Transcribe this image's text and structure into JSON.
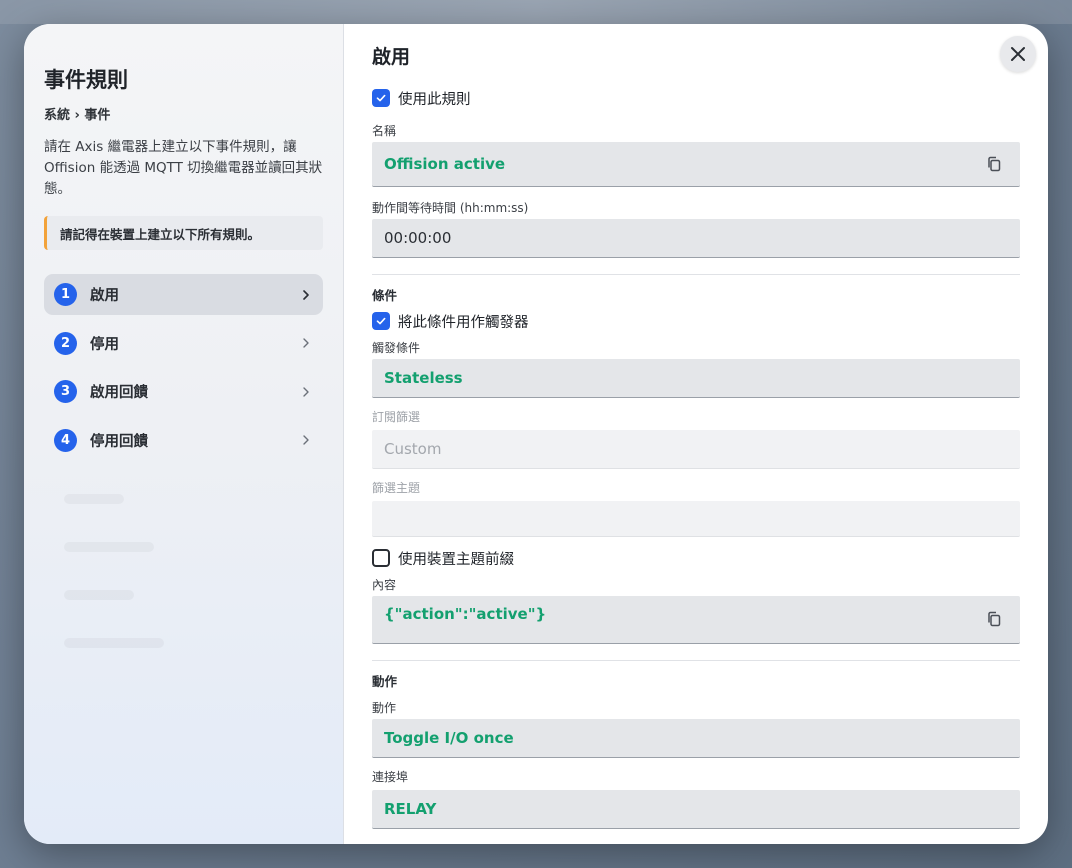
{
  "sidebar": {
    "title": "事件規則",
    "breadcrumb": "系統 › 事件",
    "description": "請在 Axis 繼電器上建立以下事件規則，讓 Offision 能透過 MQTT 切換繼電器並讀回其狀態。",
    "note": "請記得在裝置上建立以下所有規則。",
    "steps": [
      {
        "num": "1",
        "label": "啟用"
      },
      {
        "num": "2",
        "label": "停用"
      },
      {
        "num": "3",
        "label": "啟用回饋"
      },
      {
        "num": "4",
        "label": "停用回饋"
      }
    ]
  },
  "main": {
    "title": "啟用",
    "use_rule_label": "使用此規則",
    "name_label": "名稱",
    "name_value": "Offision active",
    "wait_label": "動作間等待時間 (hh:mm:ss)",
    "wait_value": "00:00:00",
    "condition_section": "條件",
    "use_trigger_label": "將此條件用作觸發器",
    "trigger_label": "觸發條件",
    "trigger_value": "Stateless",
    "subscription_label": "訂閱篩選",
    "subscription_value": "Custom",
    "filter_topic_label": "篩選主題",
    "filter_topic_value": "",
    "device_prefix_label": "使用裝置主題前綴",
    "content_label": "內容",
    "content_value": "{\"action\":\"active\"}",
    "action_section": "動作",
    "action_label": "動作",
    "action_value": "Toggle I/O once",
    "port_label": "連接埠",
    "port_value": "RELAY"
  },
  "colors": {
    "accent": "#2563eb",
    "value_green": "#13a06f",
    "note_border": "#f2a23a"
  },
  "icons": {
    "close": "close-icon",
    "copy": "copy-icon",
    "chevron": "chevron-right-icon",
    "check": "check-icon"
  }
}
